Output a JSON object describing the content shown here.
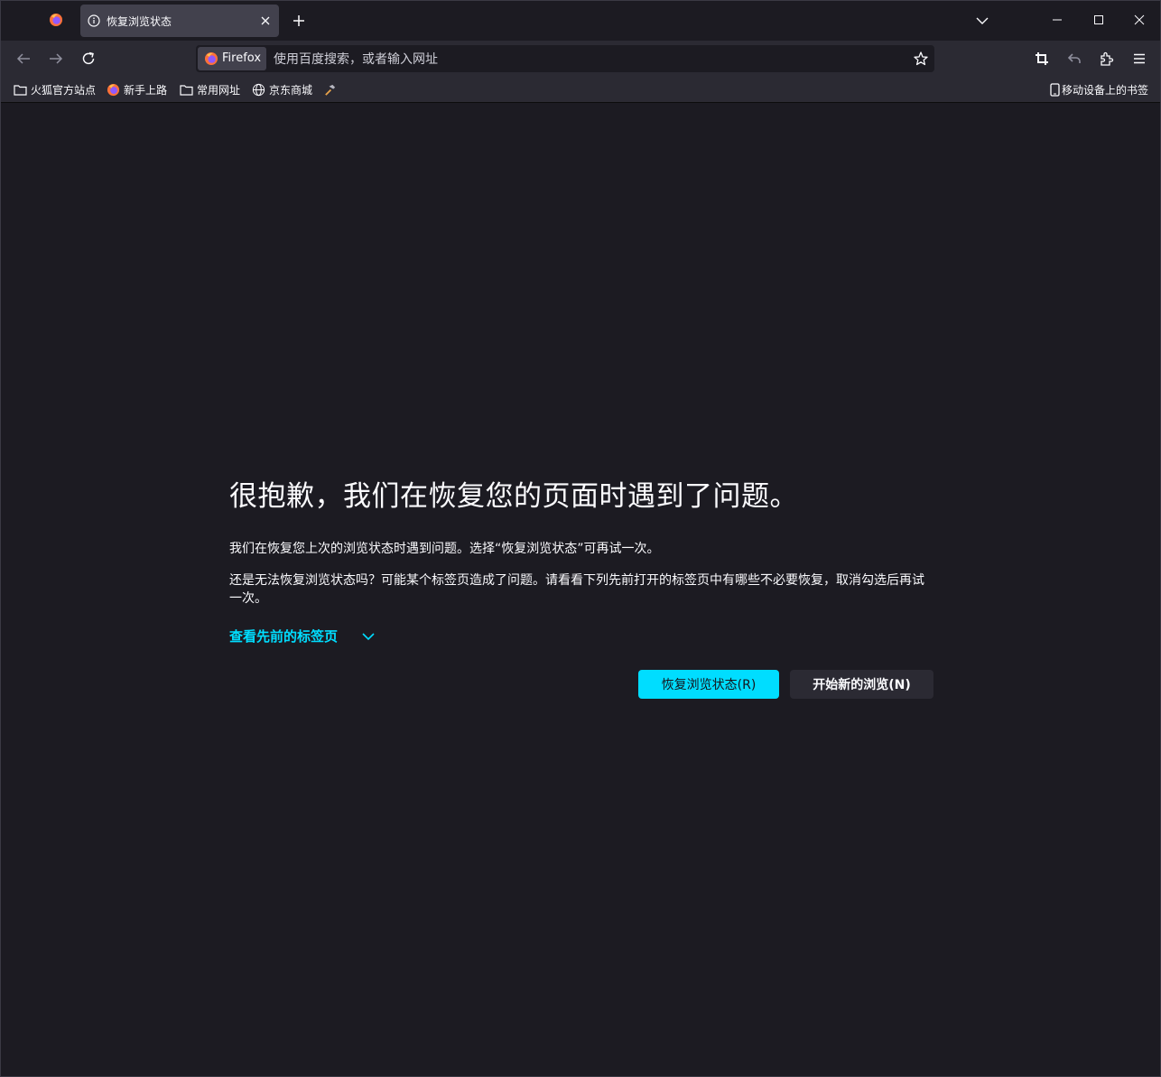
{
  "tab": {
    "title": "恢复浏览状态"
  },
  "urlbar": {
    "identity_label": "Firefox",
    "placeholder": "使用百度搜索，或者输入网址"
  },
  "bookmarks": {
    "items": [
      {
        "label": "火狐官方站点",
        "icon": "folder-icon"
      },
      {
        "label": "新手上路",
        "icon": "firefox-icon"
      },
      {
        "label": "常用网址",
        "icon": "folder-icon"
      },
      {
        "label": "京东商城",
        "icon": "globe-icon"
      }
    ],
    "mobile_label": "移动设备上的书签"
  },
  "page": {
    "title": "很抱歉，我们在恢复您的页面时遇到了问题。",
    "paragraph1": "我们在恢复您上次的浏览状态时遇到问题。选择“恢复浏览状态”可再试一次。",
    "paragraph2": "还是无法恢复浏览状态吗？可能某个标签页造成了问题。请看看下列先前打开的标签页中有哪些不必要恢复，取消勾选后再试一次。",
    "toggle_label": "查看先前的标签页",
    "restore_button": "恢复浏览状态(R)",
    "new_session_button": "开始新的浏览(N)"
  },
  "colors": {
    "accent": "#00ddff",
    "background": "#1c1b22",
    "toolbar": "#2b2a33"
  }
}
